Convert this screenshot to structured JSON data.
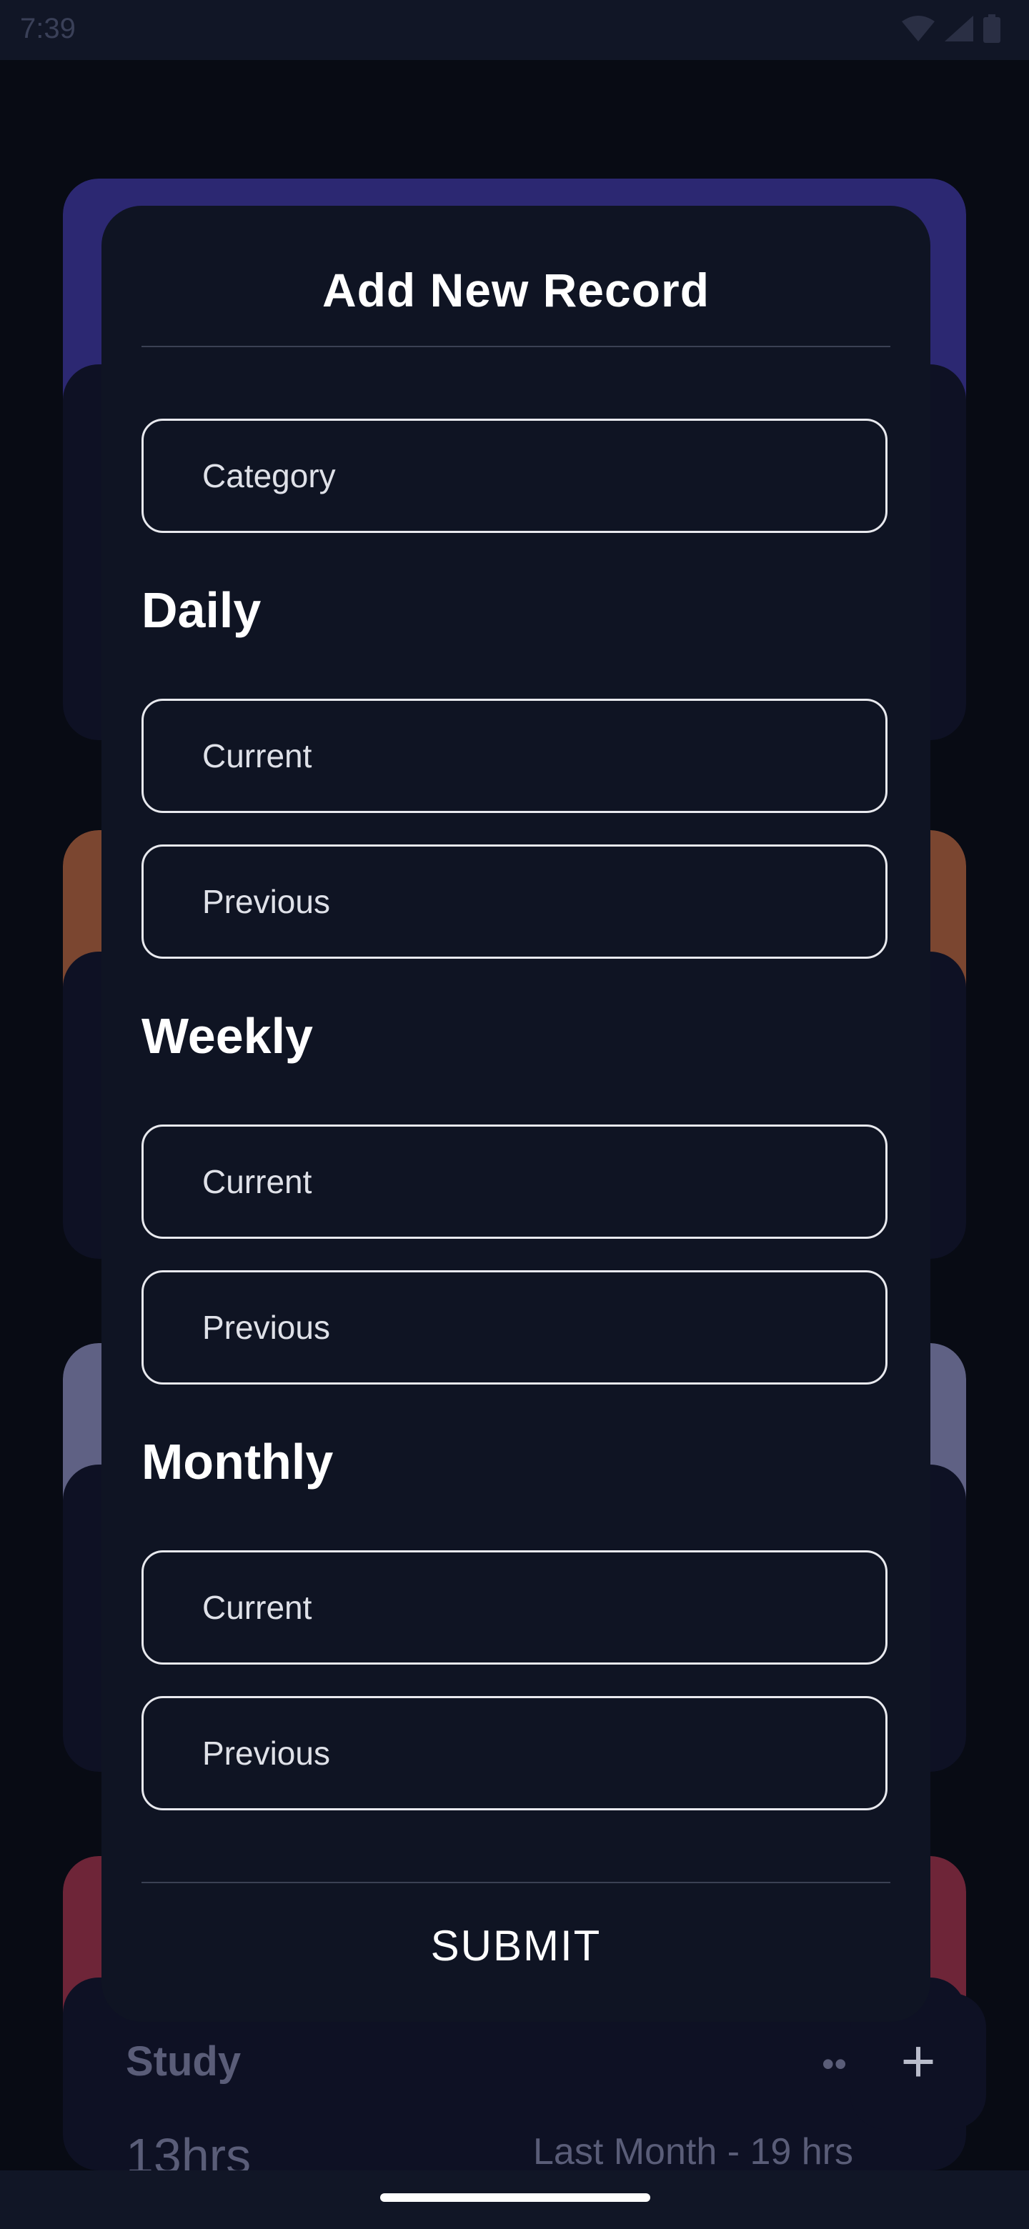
{
  "status_bar": {
    "time": "7:39"
  },
  "dialog": {
    "title": "Add New Record",
    "category_placeholder": "Category",
    "sections": [
      {
        "label": "Daily",
        "current_placeholder": "Current",
        "previous_placeholder": "Previous"
      },
      {
        "label": "Weekly",
        "current_placeholder": "Current",
        "previous_placeholder": "Previous"
      },
      {
        "label": "Monthly",
        "current_placeholder": "Current",
        "previous_placeholder": "Previous"
      }
    ],
    "submit_label": "SUBMIT"
  },
  "background_card": {
    "label": "Study",
    "menu_glyph": "••",
    "hours": "13hrs",
    "last_month": "Last Month - 19 hrs"
  },
  "fab_glyph": "+",
  "colors": {
    "card_purple": "#2c2872",
    "card_orange": "#7b4630",
    "card_slate": "#5f6184",
    "card_red": "#6e2538",
    "dialog_bg": "#0f1423"
  }
}
